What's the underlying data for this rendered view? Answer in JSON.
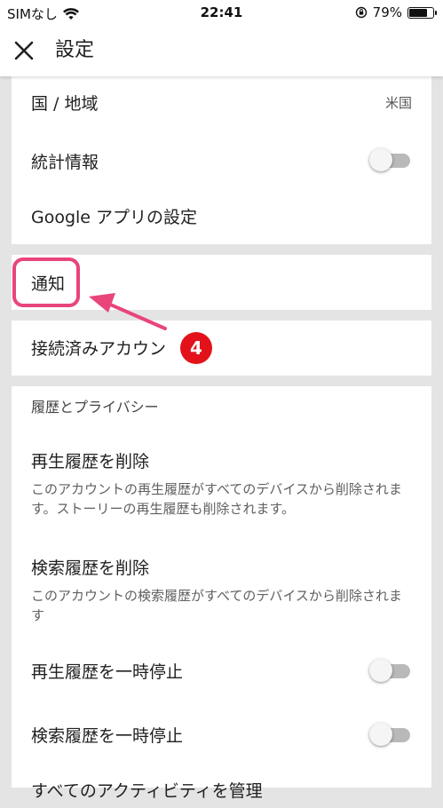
{
  "status_bar": {
    "carrier": "SIMなし",
    "time": "22:41",
    "battery": "79%",
    "battery_level": 0.79
  },
  "app_bar": {
    "title": "設定",
    "close_icon": "close-icon"
  },
  "general": {
    "country_label": "国 / 地域",
    "country_value": "米国",
    "stats_label": "統計情報",
    "stats_enabled": false,
    "google_apps_label": "Google アプリの設定"
  },
  "notifications": {
    "label": "通知"
  },
  "connected": {
    "label": "接続済みアカウン"
  },
  "history": {
    "header": "履歴とプライバシー",
    "clear_watch_label": "再生履歴を削除",
    "clear_watch_desc": "このアカウントの再生履歴がすべてのデバイスから削除されます。ストーリーの再生履歴も削除されます。",
    "clear_search_label": "検索履歴を削除",
    "clear_search_desc": "このアカウントの検索履歴がすべてのデバイスから削除されます",
    "pause_watch_label": "再生履歴を一時停止",
    "pause_watch_enabled": false,
    "pause_search_label": "検索履歴を一時停止",
    "pause_search_enabled": false,
    "manage_activity_label": "すべてのアクティビティを管理"
  },
  "annotation": {
    "step_number": "4",
    "highlight_color": "#e8457a",
    "badge_color": "#e3121a"
  },
  "colors": {
    "background": "#e4e4e4",
    "card": "#ffffff",
    "toggle_off_track": "#b9b9b9",
    "toggle_knob": "#f5f5f5"
  }
}
